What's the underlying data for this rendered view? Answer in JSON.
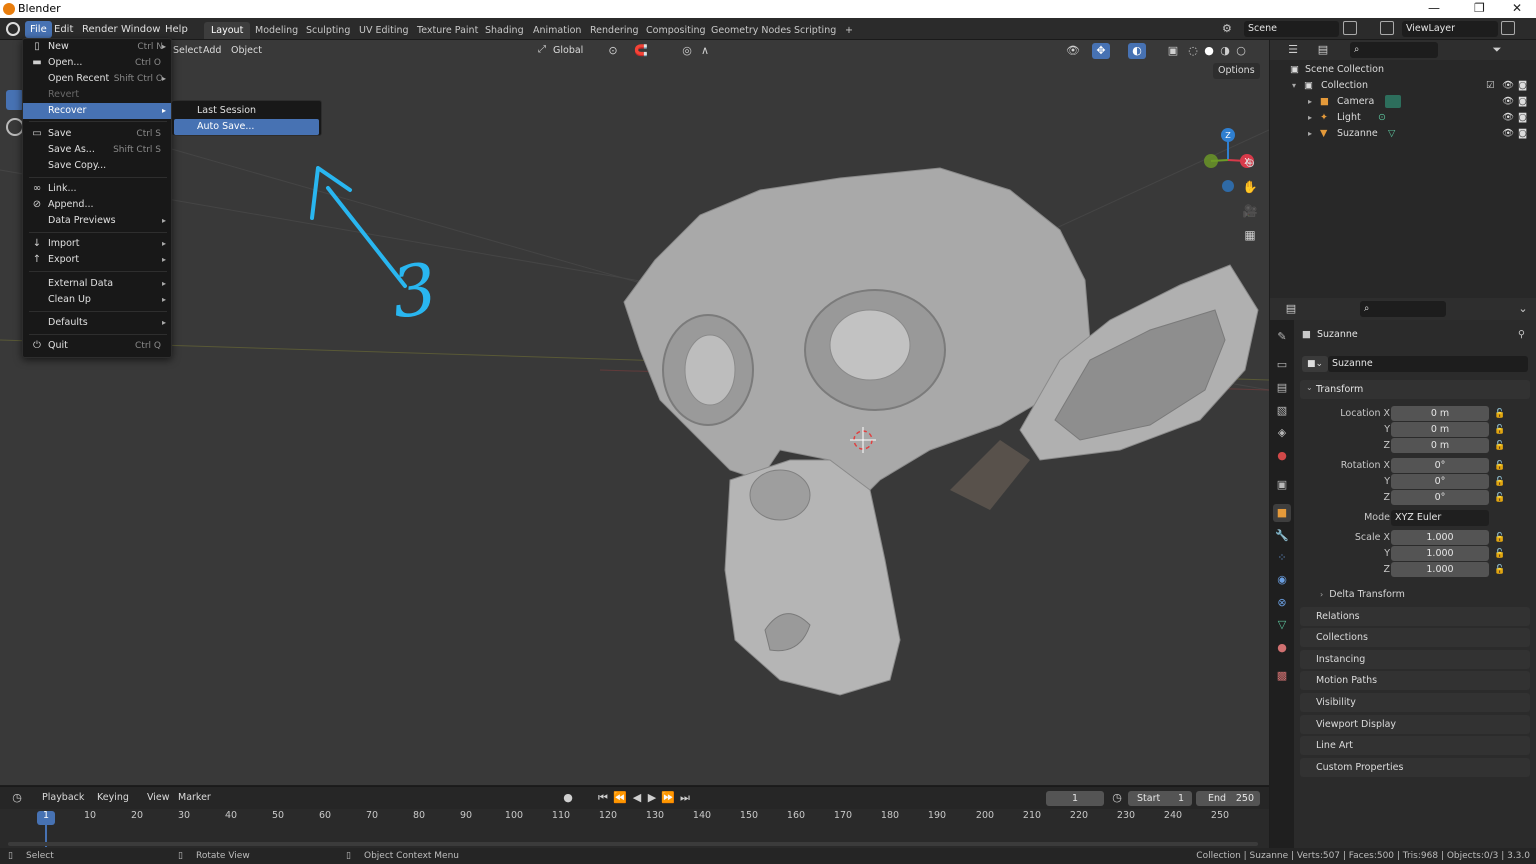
{
  "window": {
    "title": "Blender"
  },
  "menubar": {
    "menus": [
      "File",
      "Edit",
      "Render",
      "Window",
      "Help"
    ],
    "workspaces": [
      "Layout",
      "Modeling",
      "Sculpting",
      "UV Editing",
      "Texture Paint",
      "Shading",
      "Animation",
      "Rendering",
      "Compositing",
      "Geometry Nodes",
      "Scripting"
    ],
    "add_workspace": "+",
    "scene": "Scene",
    "view_layer": "ViewLayer"
  },
  "viewport_header": {
    "select": "Select",
    "add": "Add",
    "object": "Object",
    "orientation": "Global",
    "options": "Options"
  },
  "file_menu": {
    "items": [
      {
        "label": "New",
        "shortcut": "Ctrl N",
        "icon": "new-file-icon",
        "submenu": true
      },
      {
        "label": "Open...",
        "shortcut": "Ctrl O",
        "icon": "folder-icon"
      },
      {
        "label": "Open Recent",
        "shortcut": "Shift Ctrl O",
        "submenu": true
      },
      {
        "label": "Revert",
        "disabled": true
      },
      {
        "label": "Recover",
        "highlighted": true,
        "submenu": true
      },
      {
        "label": "Save",
        "shortcut": "Ctrl S",
        "icon": "save-icon"
      },
      {
        "label": "Save As...",
        "shortcut": "Shift Ctrl S"
      },
      {
        "label": "Save Copy..."
      },
      {
        "label": "Link...",
        "icon": "link-icon"
      },
      {
        "label": "Append...",
        "icon": "append-icon"
      },
      {
        "label": "Data Previews",
        "submenu": true
      },
      {
        "label": "Import",
        "icon": "import-icon",
        "submenu": true
      },
      {
        "label": "Export",
        "icon": "export-icon",
        "submenu": true
      },
      {
        "label": "External Data",
        "submenu": true
      },
      {
        "label": "Clean Up",
        "submenu": true
      },
      {
        "label": "Defaults",
        "submenu": true
      },
      {
        "label": "Quit",
        "shortcut": "Ctrl Q",
        "icon": "power-icon"
      }
    ]
  },
  "recover_submenu": {
    "items": [
      "Last Session",
      "Auto Save..."
    ]
  },
  "annotation": {
    "text": "3",
    "color": "#29b6f0"
  },
  "outliner": {
    "root": "Scene Collection",
    "collection": "Collection",
    "objects": [
      "Camera",
      "Light",
      "Suzanne"
    ]
  },
  "properties": {
    "object_name": "Suzanne",
    "data_name": "Suzanne",
    "transform_title": "Transform",
    "location_label": "Location X",
    "rotation_label": "Rotation X",
    "scale_label": "Scale X",
    "axis_y": "Y",
    "axis_z": "Z",
    "location": [
      "0 m",
      "0 m",
      "0 m"
    ],
    "rotation": [
      "0°",
      "0°",
      "0°"
    ],
    "mode_label": "Mode",
    "mode": "XYZ Euler",
    "scale": [
      "1.000",
      "1.000",
      "1.000"
    ],
    "delta": "Delta Transform",
    "panels": [
      "Relations",
      "Collections",
      "Instancing",
      "Motion Paths",
      "Visibility",
      "Viewport Display",
      "Line Art",
      "Custom Properties"
    ]
  },
  "timeline": {
    "playback": "Playback",
    "keying": "Keying",
    "view": "View",
    "marker": "Marker",
    "current_frame": "1",
    "start_label": "Start",
    "start": "1",
    "end_label": "End",
    "end": "250",
    "ruler": [
      "1",
      "10",
      "20",
      "30",
      "40",
      "50",
      "60",
      "70",
      "80",
      "90",
      "100",
      "110",
      "120",
      "130",
      "140",
      "150",
      "160",
      "170",
      "180",
      "190",
      "200",
      "210",
      "220",
      "230",
      "240",
      "250"
    ]
  },
  "statusbar": {
    "select": "Select",
    "rotate": "Rotate View",
    "context": "Object Context Menu",
    "stats": "Collection | Suzanne | Verts:507 | Faces:500 | Tris:968 | Objects:0/3 | 3.3.0"
  }
}
